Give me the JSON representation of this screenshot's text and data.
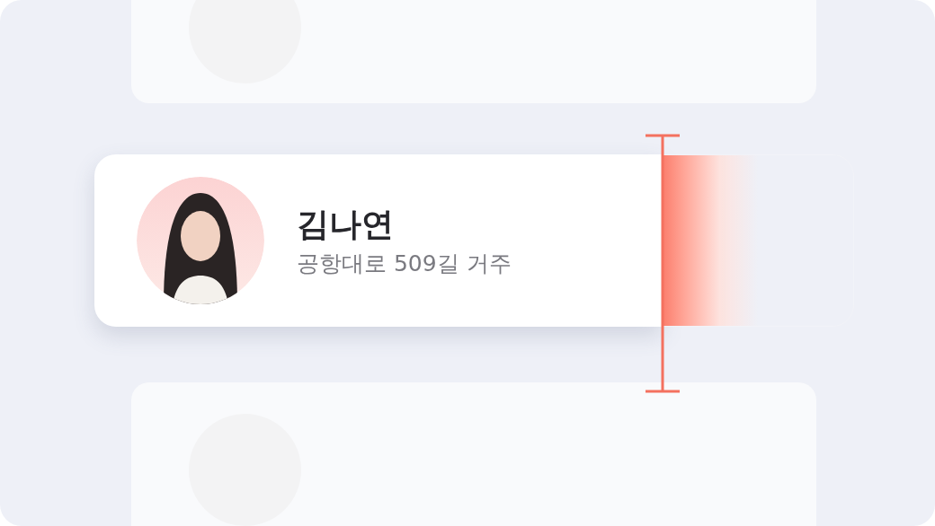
{
  "card": {
    "name": "김나연",
    "address": "공항대로 509길 거주"
  }
}
